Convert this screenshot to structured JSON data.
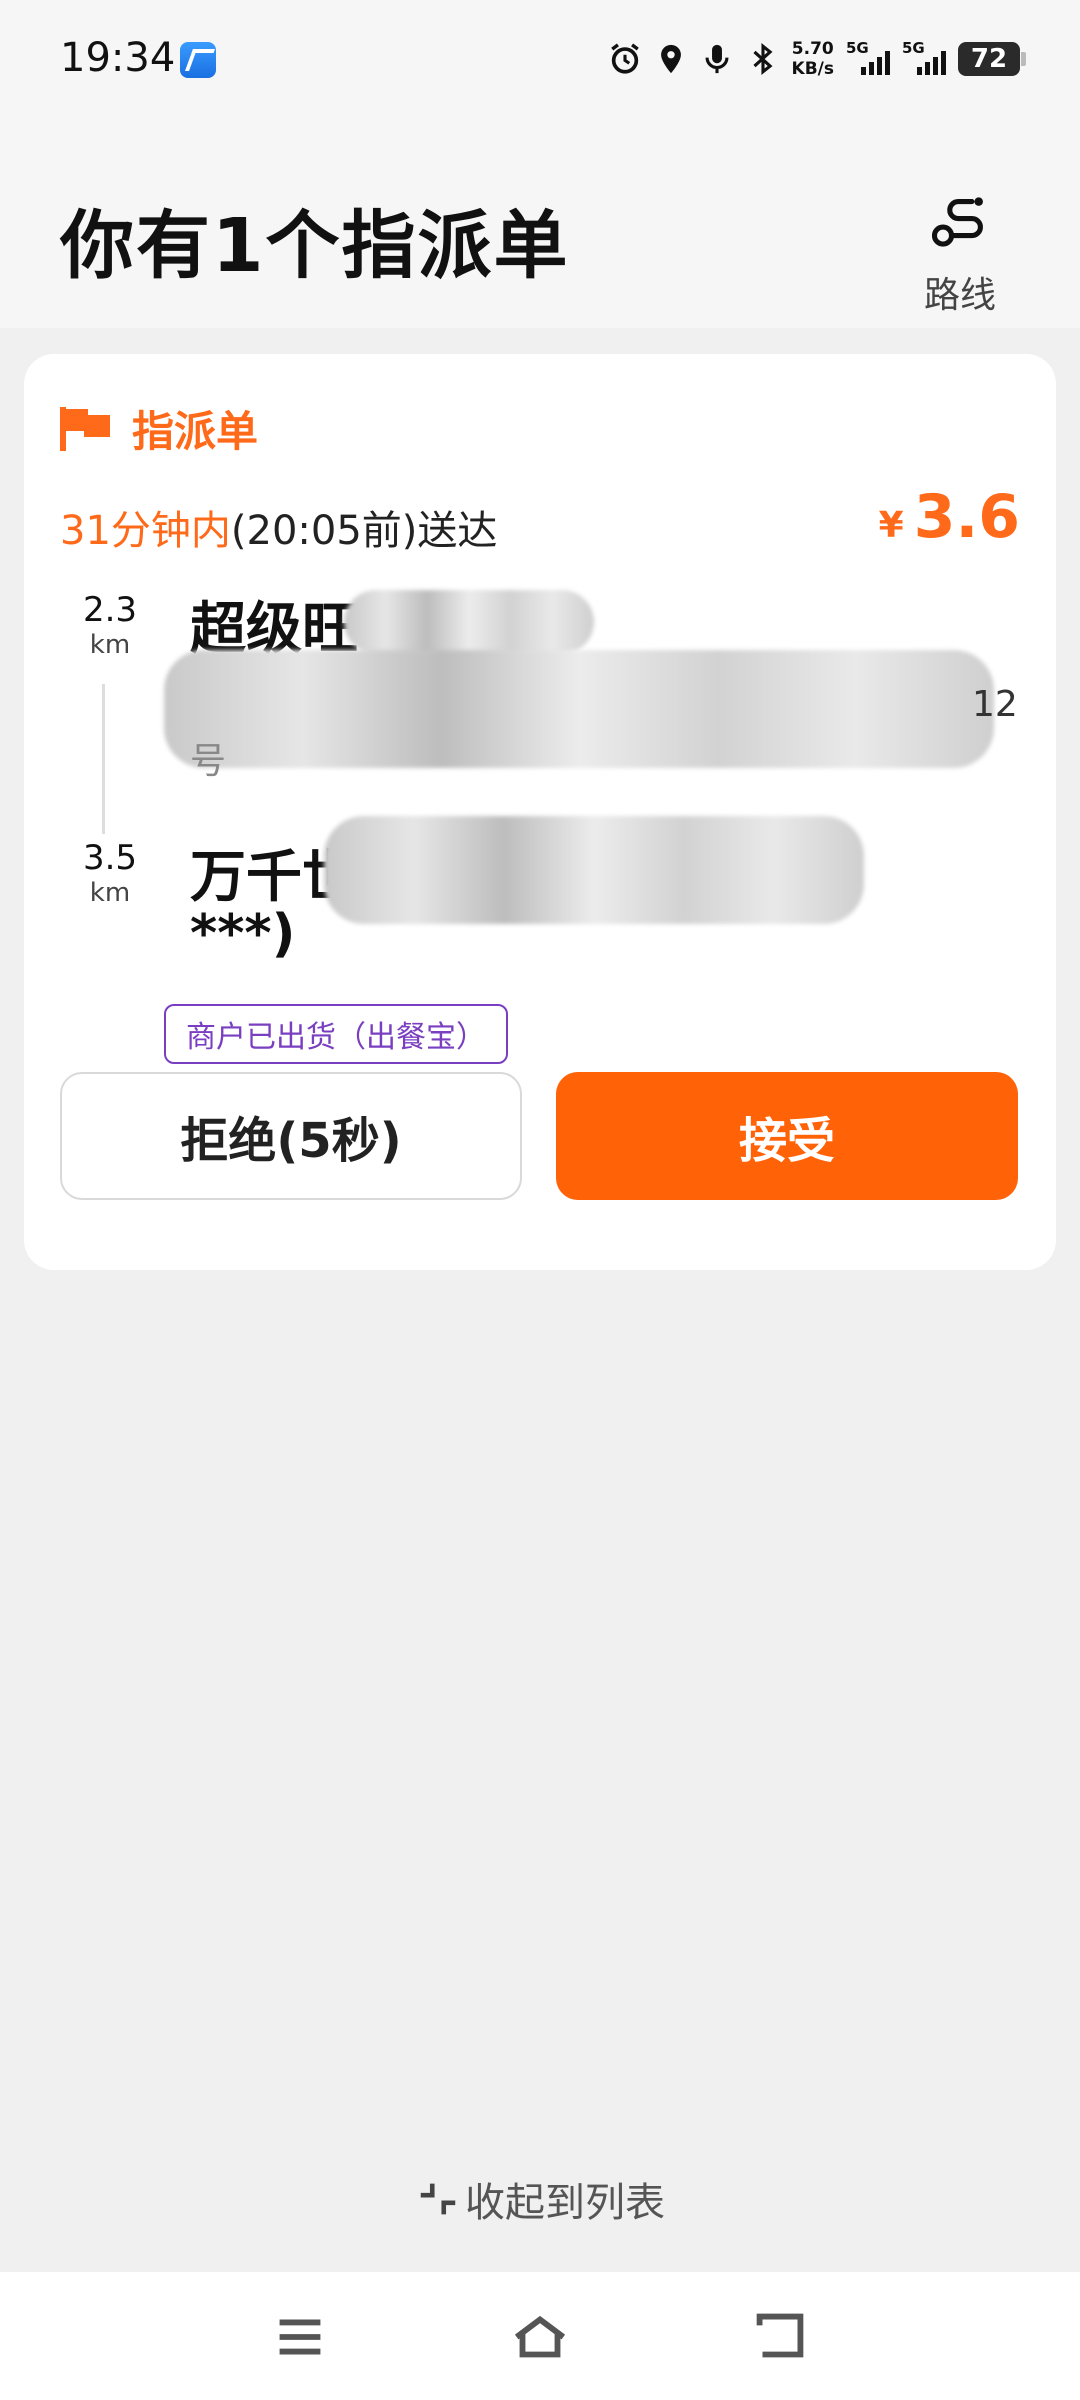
{
  "status_bar": {
    "time": "19:34",
    "net_speed_value": "5.70",
    "net_speed_unit": "KB/s",
    "sim1_label": "5G",
    "sim2_label": "5G",
    "battery": "72"
  },
  "header": {
    "title": "你有1个指派单",
    "route_label": "路线"
  },
  "order": {
    "tag_label": "指派单",
    "deadline_highlight": "31分钟内",
    "deadline_rest": "(20:05前)送达",
    "currency": "¥",
    "price": "3.6",
    "pickup": {
      "distance": "2.3",
      "unit": "km",
      "name_visible": "超级旺",
      "address_tail": "12",
      "address_line2": "号"
    },
    "dropoff": {
      "distance": "3.5",
      "unit": "km",
      "name_visible": "万千世",
      "line2": "***)"
    },
    "status_chip": "商户已出货（出餐宝）",
    "reject_label": "拒绝(5秒)",
    "accept_label": "接受"
  },
  "collapse_label": "收起到列表",
  "colors": {
    "accent": "#ff6207",
    "tag_orange": "#ff6a1a",
    "chip_purple": "#7a3fc0"
  }
}
